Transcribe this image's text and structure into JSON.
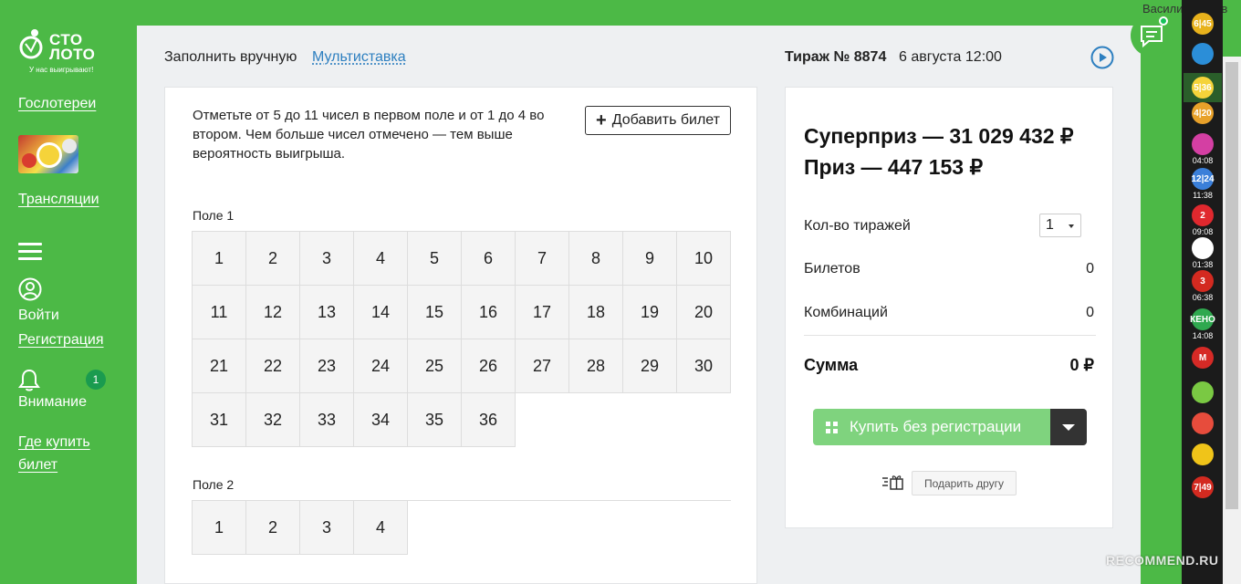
{
  "header": {
    "user_name": "Василий Ионов"
  },
  "logo": {
    "line1": "СТО",
    "line2": "ЛОТО",
    "tagline": "У нас выигрывают!"
  },
  "sidebar": {
    "gos_lotteries": "Гослотереи",
    "broadcasts": "Трансляции",
    "login": "Войти",
    "register": "Регистрация",
    "attention": "Внимание",
    "attention_count": "1",
    "where_to_buy_1": "Где купить",
    "where_to_buy_2": "билет"
  },
  "tabs": {
    "manual": "Заполнить вручную",
    "multi": "Мультиставка"
  },
  "draw": {
    "number_label": "Тираж № 8874",
    "date": "6 августа 12:00"
  },
  "ticket": {
    "instructions": "Отметьте от 5 до 11 чисел в первом поле и от 1 до 4 во втором. Чем больше чисел отмечено — тем выше вероятность выигрыша.",
    "add_ticket": "Добавить билет",
    "field1_label": "Поле 1",
    "field1_numbers": [
      "1",
      "2",
      "3",
      "4",
      "5",
      "6",
      "7",
      "8",
      "9",
      "10",
      "11",
      "12",
      "13",
      "14",
      "15",
      "16",
      "17",
      "18",
      "19",
      "20",
      "21",
      "22",
      "23",
      "24",
      "25",
      "26",
      "27",
      "28",
      "29",
      "30",
      "31",
      "32",
      "33",
      "34",
      "35",
      "36"
    ],
    "field2_label": "Поле 2",
    "field2_numbers": [
      "1",
      "2",
      "3",
      "4"
    ]
  },
  "summary": {
    "superprize": "Суперприз — 31 029 432 ₽",
    "prize": "Приз — 447 153 ₽",
    "draws_label": "Кол-во тиражей",
    "draws_value": "1",
    "tickets_label": "Билетов",
    "tickets_value": "0",
    "combinations_label": "Комбинаций",
    "combinations_value": "0",
    "total_label": "Сумма",
    "total_value": "0 ₽",
    "buy_button": "Купить без регистрации",
    "gift_button": "Подарить другу"
  },
  "games": [
    {
      "label": "6|45",
      "time": "",
      "color": "#e8b21c"
    },
    {
      "label": "",
      "time": "",
      "color": "#2b8ed8"
    },
    {
      "label": "5|36",
      "time": "",
      "color": "#f5d33a"
    },
    {
      "label": "4|20",
      "time": "",
      "color": "#e8a12a"
    },
    {
      "label": "",
      "time": "04:08",
      "color": "#d43fa3"
    },
    {
      "label": "12|24",
      "time": "11:38",
      "color": "#3a7fd9"
    },
    {
      "label": "2",
      "time": "09:08",
      "color": "#e0282e"
    },
    {
      "label": "",
      "time": "01:38",
      "color": "#ffffff"
    },
    {
      "label": "3",
      "time": "06:38",
      "color": "#d32a20"
    },
    {
      "label": "КЕНО",
      "time": "14:08",
      "color": "#2fa84f"
    },
    {
      "label": "М",
      "time": "",
      "color": "#d62a26"
    },
    {
      "label": "",
      "time": "",
      "color": "#7ac943"
    },
    {
      "label": "",
      "time": "",
      "color": "#e74c3c"
    },
    {
      "label": "",
      "time": "",
      "color": "#f0c419"
    },
    {
      "label": "7|49",
      "time": "",
      "color": "#d32a20"
    }
  ],
  "watermark": "RECOMMEND.RU"
}
